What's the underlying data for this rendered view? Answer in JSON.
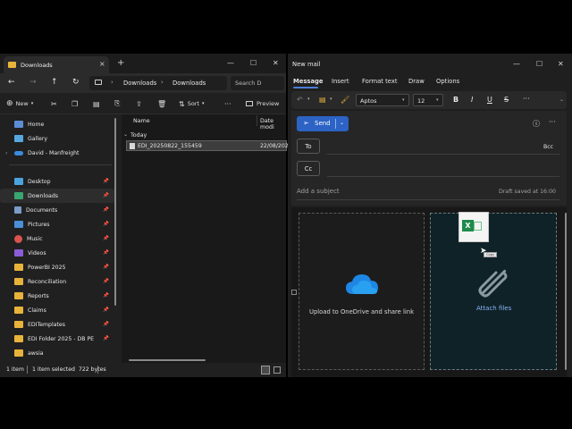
{
  "explorer": {
    "tab_title": "Downloads",
    "breadcrumb": [
      "Downloads",
      "Downloads"
    ],
    "search_placeholder": "Search D",
    "toolbar": {
      "new": "New",
      "sort": "Sort",
      "preview": "Preview"
    },
    "nav": [
      {
        "label": "Home",
        "icon": "home-icon",
        "pinned": false,
        "expand": false
      },
      {
        "label": "Gallery",
        "icon": "gallery-icon",
        "pinned": false,
        "expand": false
      },
      {
        "label": "David - Manfreight",
        "icon": "onedrive-icon",
        "pinned": false,
        "expand": true
      },
      {
        "label": "Desktop",
        "icon": "desktop-icon",
        "pinned": true,
        "expand": false
      },
      {
        "label": "Downloads",
        "icon": "downloads-icon",
        "pinned": true,
        "expand": false,
        "selected": true
      },
      {
        "label": "Documents",
        "icon": "documents-icon",
        "pinned": true,
        "expand": false
      },
      {
        "label": "Pictures",
        "icon": "pictures-icon",
        "pinned": true,
        "expand": false
      },
      {
        "label": "Music",
        "icon": "music-icon",
        "pinned": true,
        "expand": false
      },
      {
        "label": "Videos",
        "icon": "videos-icon",
        "pinned": true,
        "expand": false
      },
      {
        "label": "PowerBI 2025",
        "icon": "folder-icon",
        "pinned": true,
        "expand": false
      },
      {
        "label": "Reconciliation",
        "icon": "folder-icon",
        "pinned": true,
        "expand": false
      },
      {
        "label": "Reports",
        "icon": "folder-icon",
        "pinned": true,
        "expand": false
      },
      {
        "label": "Claims",
        "icon": "folder-icon",
        "pinned": true,
        "expand": false
      },
      {
        "label": "EDITemplates",
        "icon": "folder-icon",
        "pinned": true,
        "expand": false
      },
      {
        "label": "EDI Folder 2025 - DB PE",
        "icon": "folder-icon",
        "pinned": true,
        "expand": false
      },
      {
        "label": "awsia",
        "icon": "folder-icon",
        "pinned": false,
        "expand": false
      }
    ],
    "columns": {
      "name": "Name",
      "date": "Date modi"
    },
    "group": "Today",
    "file": {
      "name": "EDI_20250822_155459",
      "date": "22/08/202"
    },
    "status": {
      "count": "1 item",
      "selected": "1 item selected  722 bytes"
    }
  },
  "mail": {
    "title": "New mail",
    "tabs": [
      "Message",
      "Insert",
      "Format text",
      "Draw",
      "Options"
    ],
    "font_name": "Aptos",
    "font_size": "12",
    "send_label": "Send",
    "to_label": "To",
    "bcc_label": "Bcc",
    "cc_label": "Cc",
    "subject_placeholder": "Add a subject",
    "draft_status": "Draft saved at 16:00",
    "upload_label": "Upload to OneDrive and share link",
    "attach_label": "Attach files",
    "drag_hint": "Copy"
  },
  "colors": {
    "accent": "#4a7fd8",
    "send_button": "#2c63c4",
    "attach_link": "#8ab4f8",
    "folder": "#e8b33a",
    "excel": "#1f8a4c"
  }
}
